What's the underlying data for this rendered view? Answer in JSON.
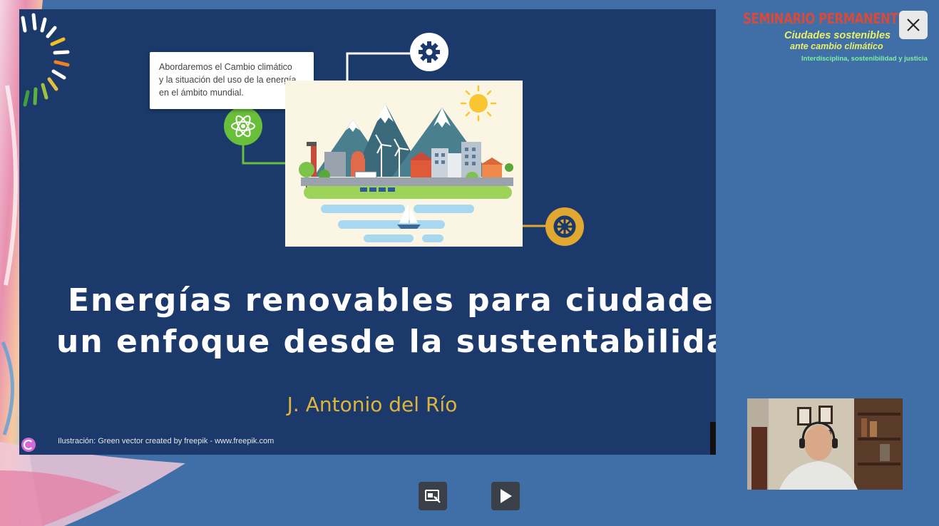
{
  "slide": {
    "callout_lines": [
      "Abordaremos el Cambio climático",
      "y la situación del uso de la energía",
      "en el ámbito mundial."
    ],
    "title_line1": "Energías renovables para  ciudades",
    "title_line2": "un enfoque desde la sustentabilidad",
    "author": "J. Antonio del Río",
    "credit": "Ilustración: Green vector created by freepik - www.freepik.com"
  },
  "branding": {
    "line1": "SEMINARIO PERMANENTE",
    "line2": "Ciudades sostenibles",
    "line3": "ante cambio climático",
    "line4": "Interdisciplina, sostenibilidad y justicia"
  },
  "icons": {
    "close": "close-icon",
    "gear": "gear-icon",
    "atom": "atom-icon",
    "wheel": "ship-wheel-icon",
    "presenter_view": "presenter-view-icon",
    "play": "play-icon",
    "logo": "logo-icon"
  },
  "colors": {
    "background": "#3f6fa6",
    "slide_bg": "#1b3a6b",
    "author": "#e0b43c",
    "brand_red": "#d84a3a",
    "brand_yellow": "#e8f06a",
    "brand_green": "#7ff0a0"
  }
}
